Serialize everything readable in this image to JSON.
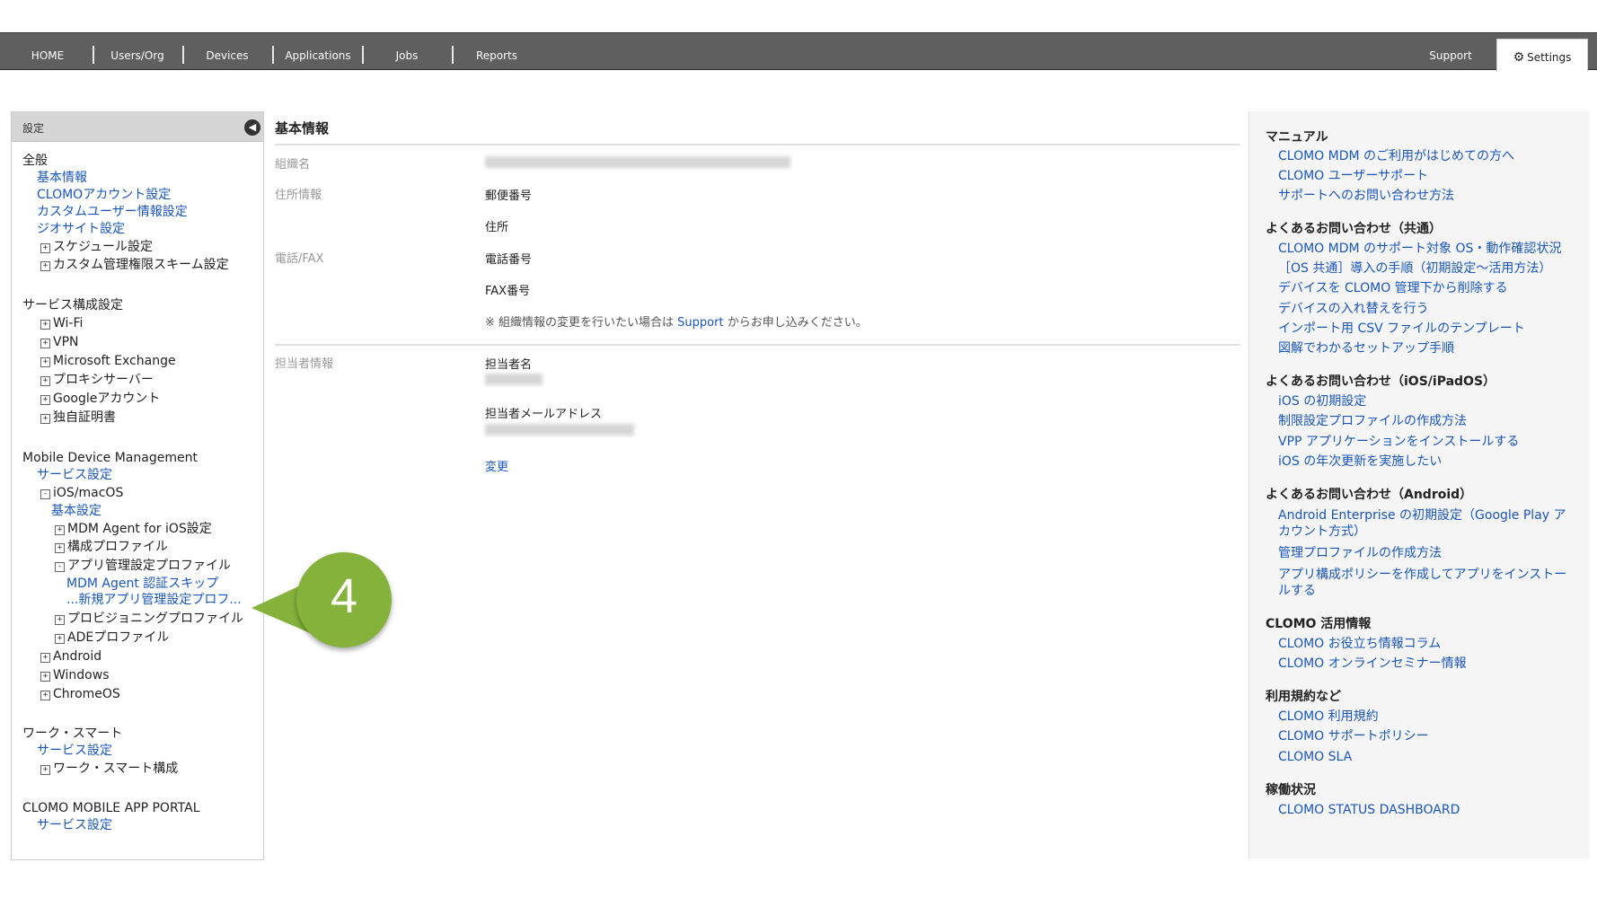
{
  "nav": {
    "items": [
      "HOME",
      "Users/Org",
      "Devices",
      "Applications",
      "Jobs",
      "Reports"
    ],
    "support": "Support",
    "settings": "Settings"
  },
  "sidebar": {
    "title": "設定",
    "general": {
      "heading": "全般",
      "basic_info": "基本情報",
      "clomo_account": "CLOMOアカウント設定",
      "custom_user": "カスタムユーザー情報設定",
      "geosite": "ジオサイト設定",
      "schedule": "スケジュール設定",
      "custom_perm": "カスタム管理権限スキーム設定"
    },
    "service_config": {
      "heading": "サービス構成設定",
      "wifi": "Wi-Fi",
      "vpn": "VPN",
      "exchange": "Microsoft Exchange",
      "proxy": "プロキシサーバー",
      "google": "Googleアカウント",
      "cert": "独自証明書"
    },
    "mdm": {
      "heading": "Mobile Device Management",
      "service": "サービス設定",
      "ios": "iOS/macOS",
      "ios_basic": "基本設定",
      "agent": "MDM Agent for iOS設定",
      "config_profile": "構成プロファイル",
      "app_profile": "アプリ管理設定プロファイル",
      "auth_skip": "MDM Agent 認証スキップ",
      "new_app_profile": "...新規アプリ管理設定プロフ...",
      "provisioning": "プロビジョニングプロファイル",
      "ade": "ADEプロファイル",
      "android": "Android",
      "windows": "Windows",
      "chromeos": "ChromeOS"
    },
    "work_smart": {
      "heading": "ワーク・スマート",
      "service": "サービス設定",
      "config": "ワーク・スマート構成"
    },
    "portal": {
      "heading": "CLOMO MOBILE APP PORTAL",
      "service": "サービス設定"
    }
  },
  "main": {
    "title": "基本情報",
    "org_name_label": "組織名",
    "address_label": "住所情報",
    "postal": "郵便番号",
    "address": "住所",
    "phone_label": "電話/FAX",
    "phone": "電話番号",
    "fax": "FAX番号",
    "note_pre": "※ 組織情報の変更を行いたい場合は",
    "note_link": "Support",
    "note_post": "からお申し込みください。",
    "contact_label": "担当者情報",
    "contact_name": "担当者名",
    "contact_email": "担当者メールアドレス",
    "change": "変更"
  },
  "right": {
    "manual": {
      "heading": "マニュアル",
      "links": [
        "CLOMO MDM のご利用がはじめての方へ",
        "CLOMO ユーザーサポート",
        "サポートへのお問い合わせ方法"
      ]
    },
    "faq_common": {
      "heading": "よくあるお問い合わせ（共通）",
      "links": [
        "CLOMO MDM のサポート対象 OS・動作確認状況",
        "［OS 共通］導入の手順（初期設定〜活用方法）",
        "デバイスを CLOMO 管理下から削除する",
        "デバイスの入れ替えを行う",
        "インポート用 CSV ファイルのテンプレート",
        "図解でわかるセットアップ手順"
      ]
    },
    "faq_ios": {
      "heading": "よくあるお問い合わせ（iOS/iPadOS）",
      "links": [
        "iOS の初期設定",
        "制限設定プロファイルの作成方法",
        "VPP アプリケーションをインストールする",
        "iOS の年次更新を実施したい"
      ]
    },
    "faq_android": {
      "heading": "よくあるお問い合わせ（Android）",
      "link1_l1": "Android Enterprise の初期設定（Google Play ア",
      "link1_l2": "カウント方式）",
      "link2": "管理プロファイルの作成方法",
      "link3_l1": "アプリ構成ポリシーを作成してアプリをインストー",
      "link3_l2": "ルする"
    },
    "clomo_info": {
      "heading": "CLOMO 活用情報",
      "links": [
        "CLOMO お役立ち情報コラム",
        "CLOMO オンラインセミナー情報"
      ]
    },
    "terms": {
      "heading": "利用規約など",
      "links": [
        "CLOMO 利用規約",
        "CLOMO サポートポリシー",
        "CLOMO SLA"
      ]
    },
    "status": {
      "heading": "稼働状況",
      "links": [
        "CLOMO STATUS DASHBOARD"
      ]
    }
  },
  "callout": {
    "number": "4",
    "color": "#84b23a"
  }
}
